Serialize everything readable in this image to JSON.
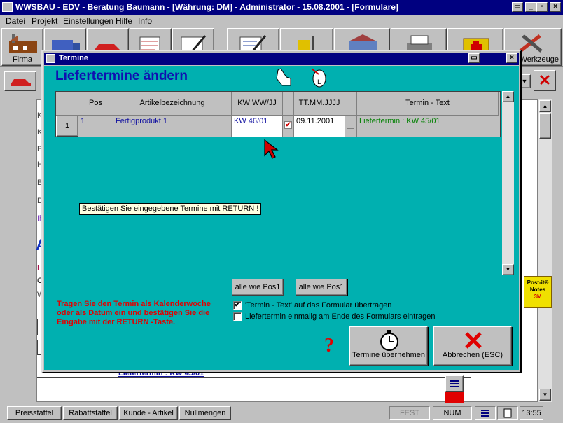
{
  "app": {
    "title": "WWSBAU - EDV - Beratung Baumann - [Währung: DM] - Administrator - 15.08.2001 - [Formulare]"
  },
  "menu": {
    "items": [
      "Datei",
      "Projekt",
      "Einstellungen",
      "Hilfe",
      "Info"
    ]
  },
  "toolbar": {
    "first_label": "Firma",
    "last_label": "Werkzeuge"
  },
  "background_doc": {
    "side_letters": [
      "K",
      "K",
      "B",
      "H",
      "B",
      "D",
      "Ih"
    ],
    "big_letter": "A",
    "small_letters": [
      "L",
      "O",
      "W"
    ],
    "bottom_link": "Liefertermin : KW 45/01"
  },
  "postit": {
    "line1": "Post-it®",
    "line2": "Notes",
    "line3": "3M"
  },
  "dialog": {
    "title": "Termine",
    "heading": "Liefertermine ändern",
    "columns": [
      "Pos",
      "Artikelbezeichnung",
      "KW WW/JJ",
      "TT.MM.JJJJ",
      "Termin - Text"
    ],
    "rows": [
      {
        "row_no": "1",
        "pos": "1",
        "article": "Fertigprodukt 1",
        "kw": "KW 46/01",
        "kw_checked": true,
        "date": "09.11.2001",
        "date_checked": false,
        "text": "Liefertermin : KW 45/01"
      }
    ],
    "tooltip": "Bestätigen Sie eingegebene Termine mit RETURN !",
    "copy_kw_button": "alle wie Pos1",
    "copy_date_button": "alle wie Pos1",
    "check_transfer_label": "'Termin - Text' auf das Formular übertragen",
    "check_transfer": true,
    "check_once_label": "Liefertermin einmalig am Ende des Formulars eintragen",
    "check_once": false,
    "help_text": "Tragen Sie den Termin als Kalenderwoche oder als Datum ein und bestätigen Sie die Eingabe mit der RETURN -Taste.",
    "apply_button": "Termine übernehmen",
    "cancel_button": "Abbrechen (ESC)"
  },
  "statusbar": {
    "buttons": [
      "Preisstaffel",
      "Rabattstaffel",
      "Kunde - Artikel",
      "Nullmengen"
    ],
    "fest": "FEST",
    "num": "NUM",
    "time": "13:55"
  }
}
